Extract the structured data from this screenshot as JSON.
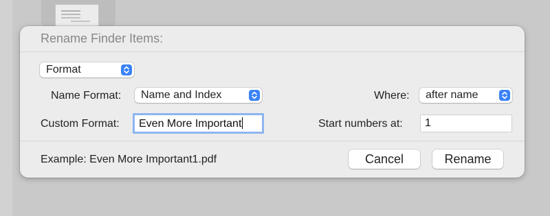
{
  "dialog": {
    "title": "Rename Finder Items:",
    "mode_popup": {
      "value": "Format"
    },
    "name_format": {
      "label": "Name Format:",
      "value": "Name and Index"
    },
    "where": {
      "label": "Where:",
      "value": "after name"
    },
    "custom_format": {
      "label": "Custom Format:",
      "value": "Even More Important"
    },
    "start_numbers": {
      "label": "Start numbers at:",
      "value": "1"
    },
    "example": "Example: Even More Important1.pdf",
    "buttons": {
      "cancel": "Cancel",
      "rename": "Rename"
    }
  },
  "colors": {
    "accent": "#3a82f7",
    "focus_ring": "#8db4f0",
    "dialog_bg": "#ececec"
  },
  "icons": {
    "popup_stepper": "up-down-chevron-icon"
  }
}
